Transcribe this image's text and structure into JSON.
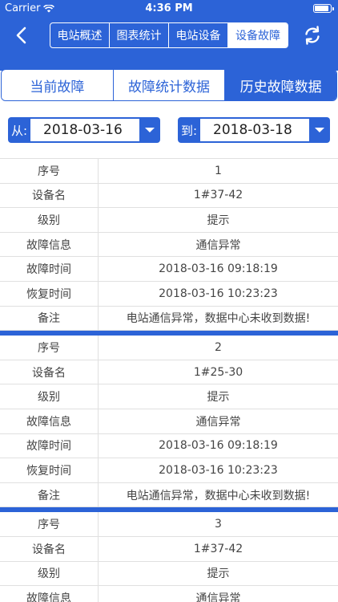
{
  "status_bar": {
    "carrier": "Carrier",
    "time": "4:36 PM",
    "battery_level": 0.9
  },
  "nav": {
    "tabs": [
      {
        "label": "电站概述",
        "active": false
      },
      {
        "label": "图表统计",
        "active": false
      },
      {
        "label": "电站设备",
        "active": false
      },
      {
        "label": "设备故障",
        "active": true
      }
    ]
  },
  "sub_tabs": [
    {
      "label": "当前故障",
      "active": false
    },
    {
      "label": "故障统计数据",
      "active": false
    },
    {
      "label": "历史故障数据",
      "active": true
    }
  ],
  "date_filter": {
    "from_label": "从:",
    "from_value": "2018-03-16",
    "to_label": "到:",
    "to_value": "2018-03-18"
  },
  "records": [
    {
      "fields": [
        {
          "label": "序号",
          "value": "1"
        },
        {
          "label": "设备名",
          "value": "1#37-42"
        },
        {
          "label": "级别",
          "value": "提示"
        },
        {
          "label": "故障信息",
          "value": "通信异常"
        },
        {
          "label": "故障时间",
          "value": "2018-03-16 09:18:19"
        },
        {
          "label": "恢复时间",
          "value": "2018-03-16 10:23:23"
        },
        {
          "label": "备注",
          "value": "电站通信异常，数据中心未收到数据!"
        }
      ]
    },
    {
      "fields": [
        {
          "label": "序号",
          "value": "2"
        },
        {
          "label": "设备名",
          "value": "1#25-30"
        },
        {
          "label": "级别",
          "value": "提示"
        },
        {
          "label": "故障信息",
          "value": "通信异常"
        },
        {
          "label": "故障时间",
          "value": "2018-03-16 09:18:19"
        },
        {
          "label": "恢复时间",
          "value": "2018-03-16 10:23:23"
        },
        {
          "label": "备注",
          "value": "电站通信异常，数据中心未收到数据!"
        }
      ]
    },
    {
      "fields": [
        {
          "label": "序号",
          "value": "3"
        },
        {
          "label": "设备名",
          "value": "1#37-42"
        },
        {
          "label": "级别",
          "value": "提示"
        },
        {
          "label": "故障信息",
          "value": "通信异常"
        }
      ]
    }
  ],
  "colors": {
    "primary": "#2c63d7",
    "border": "#e0e0e0"
  },
  "icons": {
    "back": "chevron-left-icon",
    "refresh": "refresh-icon",
    "wifi": "wifi-icon",
    "dropdown": "caret-down-icon"
  }
}
